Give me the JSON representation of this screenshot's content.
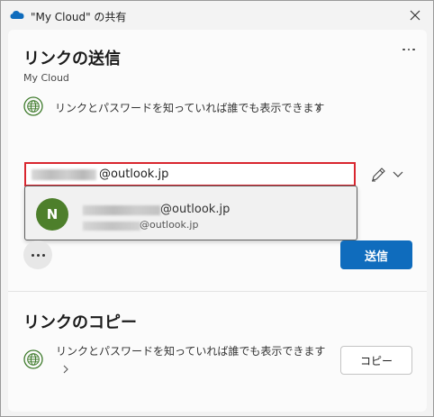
{
  "window": {
    "title": "\"My Cloud\" の共有"
  },
  "send_section": {
    "heading": "リンクの送信",
    "subheading": "My Cloud",
    "permission_text": "リンクとパスワードを知っていれば誰でも表示できます",
    "recipient_value": "@outlook.jp",
    "suggestion": {
      "avatar_initial": "N",
      "name": "@outlook.jp",
      "email": "@outlook.jp"
    },
    "send_label": "送信"
  },
  "copy_section": {
    "heading": "リンクのコピー",
    "permission_text": "リンクとパスワードを知っていれば誰でも表示できます",
    "copy_label": "コピー"
  },
  "colors": {
    "accent": "#0f6cbd",
    "input_border": "#d9262f",
    "avatar": "#4d7f2b",
    "globe": "#3d7a2a"
  }
}
